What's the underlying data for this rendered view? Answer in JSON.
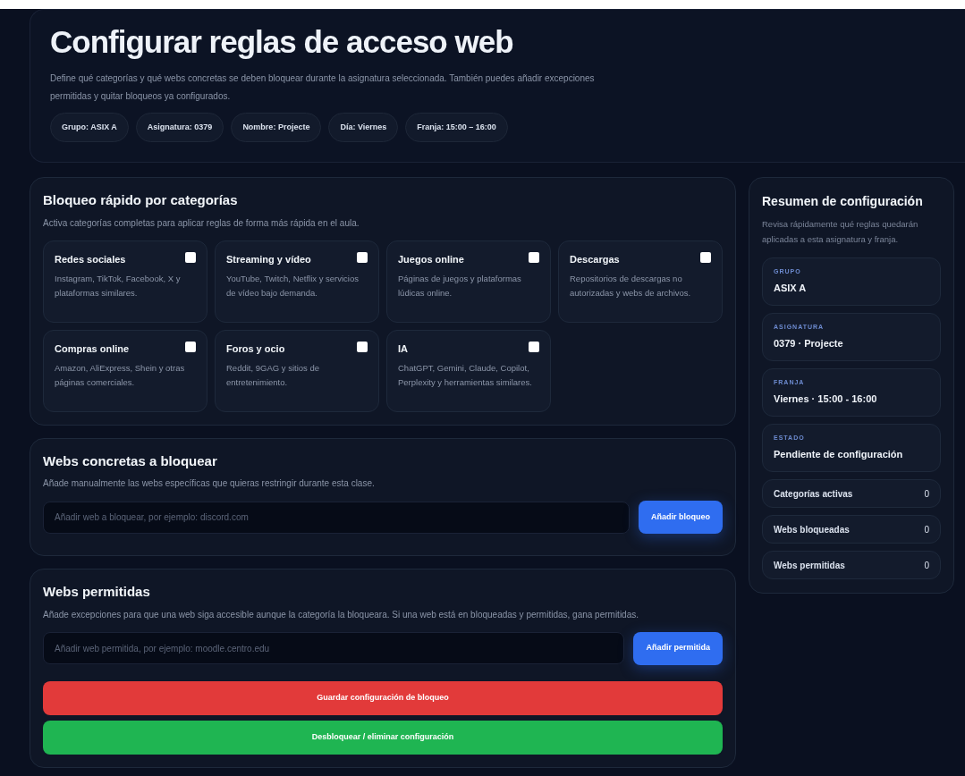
{
  "header": {
    "title": "Configurar reglas de acceso web",
    "description": "Define qué categorías y qué webs concretas se deben bloquear durante la asignatura seleccionada. También puedes añadir excepciones permitidas y quitar bloqueos ya configurados.",
    "chips": [
      "Grupo: ASIX A",
      "Asignatura: 0379",
      "Nombre: Projecte",
      "Día: Viernes",
      "Franja: 15:00 – 16:00"
    ]
  },
  "categories": {
    "title": "Bloqueo rápido por categorías",
    "description": "Activa categorías completas para aplicar reglas de forma más rápida en el aula.",
    "items": [
      {
        "name": "Redes sociales",
        "description": "Instagram, TikTok, Facebook, X y plataformas similares.",
        "checked": false
      },
      {
        "name": "Streaming y vídeo",
        "description": "YouTube, Twitch, Netflix y servicios de vídeo bajo demanda.",
        "checked": false
      },
      {
        "name": "Juegos online",
        "description": "Páginas de juegos y plataformas lúdicas online.",
        "checked": false
      },
      {
        "name": "Descargas",
        "description": "Repositorios de descargas no autorizadas y webs de archivos.",
        "checked": false
      },
      {
        "name": "Compras online",
        "description": "Amazon, AliExpress, Shein y otras páginas comerciales.",
        "checked": false
      },
      {
        "name": "Foros y ocio",
        "description": "Reddit, 9GAG y sitios de entretenimiento.",
        "checked": false
      },
      {
        "name": "IA",
        "description": "ChatGPT, Gemini, Claude, Copilot, Perplexity y herramientas similares.",
        "checked": false
      }
    ]
  },
  "blocked_sites": {
    "title": "Webs concretas a bloquear",
    "description": "Añade manualmente las webs específicas que quieras restringir durante esta clase.",
    "placeholder": "Añadir web a bloquear, por ejemplo: discord.com",
    "button": "Añadir bloqueo"
  },
  "allowed_sites": {
    "title": "Webs permitidas",
    "description": "Añade excepciones para que una web siga accesible aunque la categoría la bloqueara. Si una web está en bloqueadas y permitidas, gana permitidas.",
    "placeholder": "Añadir web permitida, por ejemplo: moodle.centro.edu",
    "button": "Añadir permitida"
  },
  "actions": [
    {
      "label": "Guardar configuración de bloqueo",
      "kind": "danger"
    },
    {
      "label": "Desbloquear / eliminar configuración",
      "kind": "success"
    }
  ],
  "summary": {
    "title": "Resumen de configuración",
    "description": "Revisa rápidamente qué reglas quedarán aplicadas a esta asignatura y franja.",
    "fields": [
      {
        "label": "GRUPO",
        "value": "ASIX A"
      },
      {
        "label": "ASIGNATURA",
        "value": "0379 · Projecte"
      },
      {
        "label": "FRANJA",
        "value": "Viernes · 15:00 - 16:00"
      },
      {
        "label": "ESTADO",
        "value": "Pendiente de configuración"
      }
    ],
    "counters": [
      {
        "label": "Categorías activas",
        "value": "0"
      },
      {
        "label": "Webs bloqueadas",
        "value": "0"
      },
      {
        "label": "Webs permitidas",
        "value": "0"
      }
    ]
  }
}
